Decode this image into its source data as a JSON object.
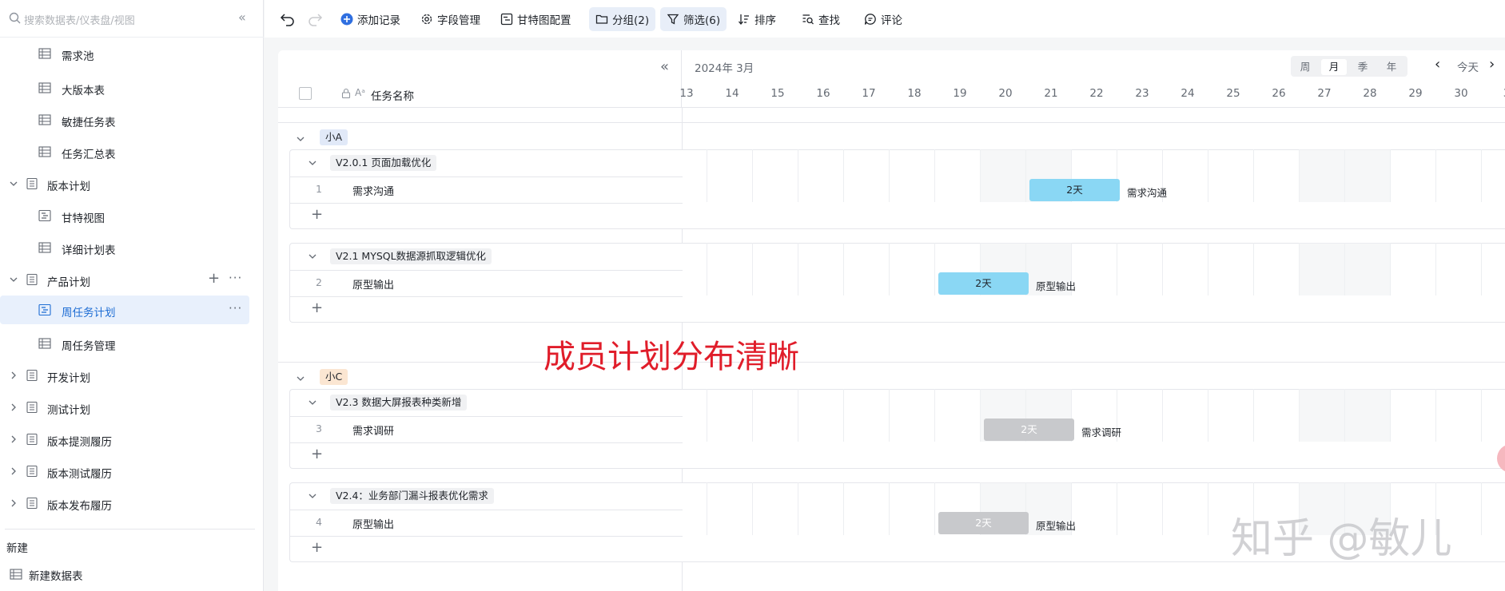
{
  "sidebar": {
    "search_placeholder": "搜索数据表/仪表盘/视图",
    "items": [
      {
        "label": "需求池"
      },
      {
        "label": "大版本表"
      },
      {
        "label": "敏捷任务表"
      },
      {
        "label": "任务汇总表"
      },
      {
        "label": "版本计划"
      },
      {
        "label": "甘特视图"
      },
      {
        "label": "详细计划表"
      },
      {
        "label": "产品计划"
      },
      {
        "label": "周任务计划"
      },
      {
        "label": "周任务管理"
      },
      {
        "label": "开发计划"
      },
      {
        "label": "测试计划"
      },
      {
        "label": "版本提测履历"
      },
      {
        "label": "版本测试履历"
      },
      {
        "label": "版本发布履历"
      }
    ],
    "new_title": "新建",
    "new_table": "新建数据表"
  },
  "toolbar": {
    "add_record": "添加记录",
    "fields": "字段管理",
    "gantt_config": "甘特图配置",
    "group": "分组(2)",
    "filter": "筛选(6)",
    "sort": "排序",
    "find": "查找",
    "comment": "评论"
  },
  "grid": {
    "task_name_header": "任务名称",
    "month": "2024年 3月",
    "scale": [
      "周",
      "月",
      "季",
      "年"
    ],
    "today": "今天",
    "days": [
      "13",
      "14",
      "15",
      "16",
      "17",
      "18",
      "19",
      "20",
      "21",
      "22",
      "23",
      "24",
      "25",
      "26",
      "27",
      "28",
      "29",
      "30",
      "3"
    ]
  },
  "groups": [
    {
      "name": "小A",
      "subgroups": [
        {
          "name": "V2.0.1 页面加载优化",
          "rows": [
            {
              "num": "1",
              "name": "需求沟通",
              "bar": "2天",
              "bar_label": "需求沟通"
            }
          ]
        },
        {
          "name": "V2.1 MYSQL数据源抓取逻辑优化",
          "rows": [
            {
              "num": "2",
              "name": "原型输出",
              "bar": "2天",
              "bar_label": "原型输出"
            }
          ]
        }
      ]
    },
    {
      "name": "小C",
      "subgroups": [
        {
          "name": "V2.3 数据大屏报表种类新增",
          "rows": [
            {
              "num": "3",
              "name": "需求调研",
              "bar": "2天",
              "bar_label": "需求调研"
            }
          ]
        },
        {
          "name": "V2.4：业务部门漏斗报表优化需求",
          "rows": [
            {
              "num": "4",
              "name": "原型输出",
              "bar": "2天",
              "bar_label": "原型输出"
            }
          ]
        }
      ]
    }
  ],
  "overlay_text": "成员计划分布清晰",
  "watermark": "知乎 @敏儿",
  "colors": {
    "accent": "#1f6ed4",
    "bar_blue": "#8ad7f4",
    "bar_grey": "#c8c9cc",
    "tag_a": "#e1e9f8",
    "tag_c": "#fbe6d2",
    "overlay": "#e01d2a"
  }
}
